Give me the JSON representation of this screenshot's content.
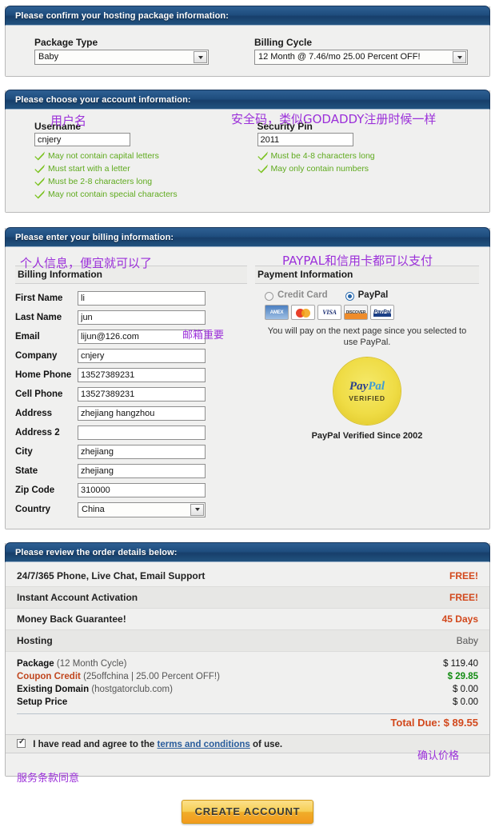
{
  "package_panel": {
    "header": "Please confirm your hosting package information:",
    "package_type_label": "Package Type",
    "package_type_value": "Baby",
    "billing_cycle_label": "Billing Cycle",
    "billing_cycle_value": "12 Month @ 7.46/mo 25.00 Percent OFF!"
  },
  "account_panel": {
    "header": "Please choose your account information:",
    "username_label": "Username",
    "username_value": "cnjery",
    "username_rules": [
      "May not contain capital letters",
      "Must start with a letter",
      "Must be 2-8 characters long",
      "May not contain special characters"
    ],
    "pin_label": "Security Pin",
    "pin_value": "2011",
    "pin_rules": [
      "Must be 4-8 characters long",
      "May only contain numbers"
    ]
  },
  "billing_panel": {
    "header": "Please enter your billing information:",
    "billing_info_title": "Billing Information",
    "fields": [
      {
        "label": "First Name",
        "value": "li",
        "type": "text"
      },
      {
        "label": "Last Name",
        "value": "jun",
        "type": "text"
      },
      {
        "label": "Email",
        "value": "lijun@126.com",
        "type": "text"
      },
      {
        "label": "Company",
        "value": "cnjery",
        "type": "text"
      },
      {
        "label": "Home Phone",
        "value": "13527389231",
        "type": "text"
      },
      {
        "label": "Cell Phone",
        "value": "13527389231",
        "type": "text"
      },
      {
        "label": "Address",
        "value": "zhejiang hangzhou",
        "type": "text"
      },
      {
        "label": "Address 2",
        "value": "",
        "type": "text"
      },
      {
        "label": "City",
        "value": "zhejiang",
        "type": "text"
      },
      {
        "label": "State",
        "value": "zhejiang",
        "type": "text"
      },
      {
        "label": "Zip Code",
        "value": "310000",
        "type": "text"
      },
      {
        "label": "Country",
        "value": "China",
        "type": "select"
      }
    ],
    "payment_info_title": "Payment Information",
    "payment_options": [
      {
        "label": "Credit Card",
        "selected": false
      },
      {
        "label": "PayPal",
        "selected": true
      }
    ],
    "card_logos": [
      "american-express",
      "mastercard",
      "visa",
      "discover",
      "paypal"
    ],
    "paypal_note": "You will pay on the next page since you selected to use PayPal.",
    "seal_brand": "PayPal",
    "seal_sub": "VERIFIED",
    "seal_caption": "PayPal Verified Since 2002"
  },
  "order_panel": {
    "header": "Please review the order details below:",
    "feature_rows": [
      {
        "label": "24/7/365 Phone, Live Chat, Email Support",
        "value": "FREE!",
        "style": "free"
      },
      {
        "label": "Instant Account Activation",
        "value": "FREE!",
        "style": "free"
      },
      {
        "label": "Money Back Guarantee!",
        "value": "45 Days",
        "style": "days"
      },
      {
        "label": "Hosting",
        "value": "Baby",
        "style": "plain"
      }
    ],
    "line_items": [
      {
        "label": "Package",
        "note": "(12 Month Cycle)",
        "amount": "$ 119.40",
        "amount_style": "normal"
      },
      {
        "label": "Coupon Credit",
        "note": "(25offchina | 25.00 Percent OFF!)",
        "amount": "$ 29.85",
        "amount_style": "green"
      },
      {
        "label": "Existing Domain",
        "note": "(hostgatorclub.com)",
        "amount": "$ 0.00",
        "amount_style": "normal"
      },
      {
        "label": "Setup Price",
        "note": "",
        "amount": "$ 0.00",
        "amount_style": "normal"
      }
    ],
    "total_label": "Total Due:",
    "total_value": "$ 89.55",
    "terms_pre": "I have read and agree to the",
    "terms_link": "terms and conditions",
    "terms_post": "of use.",
    "terms_checked": true
  },
  "submit": {
    "label": "CREATE ACCOUNT"
  },
  "annotations": {
    "username": "用户名",
    "security_pin": "安全码，类似GODADDY注册时候一样",
    "billing_info": "个人信息，便宜就可以了",
    "email": "邮箱重要",
    "payment": "PAYPAL和信用卡都可以支付",
    "confirm_price": "确认价格",
    "terms_agree": "服务条款同意"
  },
  "colors": {
    "panel_header_blue": "#1f4e7f",
    "accent_orange": "#d2481c",
    "rule_green": "#5faa1e",
    "credit_green": "#138c13",
    "annotation_purple": "#9b30d9",
    "link_blue": "#2a5d9c",
    "button_gold": "#f0ad2a"
  }
}
